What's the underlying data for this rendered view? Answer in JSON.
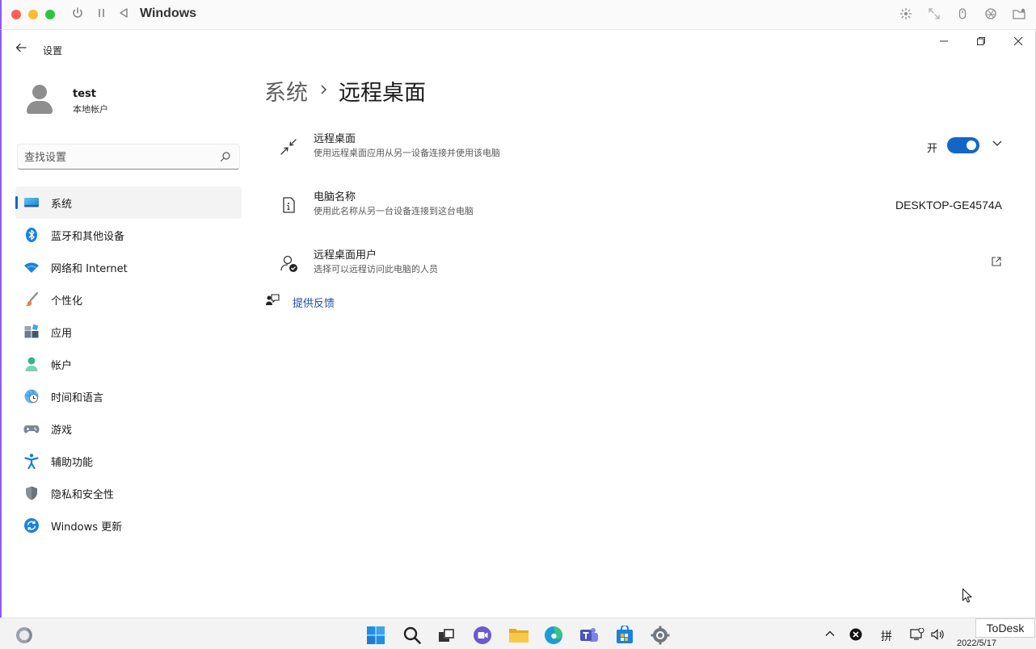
{
  "host_bar": {
    "title": "Windows",
    "icons": [
      "power-icon",
      "pause-icon",
      "back-triangle-icon",
      "brightness-icon",
      "expand-icon",
      "mouse-icon",
      "aperture-icon",
      "folder-icon"
    ]
  },
  "window": {
    "app_title": "设置",
    "controls": [
      "minimize",
      "restore",
      "close"
    ]
  },
  "profile": {
    "name": "test",
    "account_type": "本地帐户"
  },
  "search": {
    "placeholder": "查找设置"
  },
  "nav": {
    "items": [
      {
        "label": "系统",
        "icon": "system-monitor-icon",
        "active": true
      },
      {
        "label": "蓝牙和其他设备",
        "icon": "bluetooth-icon"
      },
      {
        "label": "网络和 Internet",
        "icon": "wifi-icon"
      },
      {
        "label": "个性化",
        "icon": "brush-icon"
      },
      {
        "label": "应用",
        "icon": "apps-icon"
      },
      {
        "label": "帐户",
        "icon": "account-icon"
      },
      {
        "label": "时间和语言",
        "icon": "globe-clock-icon"
      },
      {
        "label": "游戏",
        "icon": "gamepad-icon"
      },
      {
        "label": "辅助功能",
        "icon": "accessibility-icon"
      },
      {
        "label": "隐私和安全性",
        "icon": "shield-icon"
      },
      {
        "label": "Windows 更新",
        "icon": "update-icon"
      }
    ]
  },
  "breadcrumb": {
    "parent": "系统",
    "current": "远程桌面"
  },
  "settings": {
    "remote_desktop": {
      "title": "远程桌面",
      "desc": "使用远程桌面应用从另一设备连接并使用该电脑",
      "toggle_label": "开",
      "toggle_on": true
    },
    "pc_name": {
      "title": "电脑名称",
      "desc": "使用此名称从另一台设备连接到这台电脑",
      "value": "DESKTOP-GE4574A"
    },
    "remote_users": {
      "title": "远程桌面用户",
      "desc": "选择可以远程访问此电脑的人员"
    }
  },
  "feedback": {
    "label": "提供反馈"
  },
  "taskbar": {
    "apps": [
      "start-icon",
      "search-icon",
      "taskview-icon",
      "chat-icon",
      "file-explorer-icon",
      "edge-icon",
      "teams-icon",
      "store-icon",
      "settings-icon"
    ],
    "tray": {
      "ime": "拼",
      "date": "2022/5/17"
    }
  },
  "todesk": {
    "label": "ToDesk"
  },
  "colors": {
    "accent": "#1366c8",
    "link": "#1a4fa0"
  }
}
